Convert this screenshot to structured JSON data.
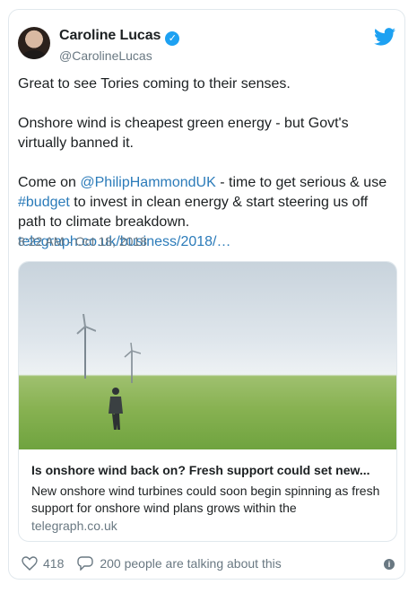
{
  "user": {
    "name": "Caroline Lucas",
    "handle": "@CarolineLucas"
  },
  "tweet": {
    "line1": "Great to see Tories coming to their senses.",
    "line2": "Onshore wind is cheapest green energy - but Govt's virtually banned it.",
    "line3_pre": "Come on ",
    "mention": "@PhilipHammondUK",
    "line3_mid": " - time to get serious & use ",
    "hashtag": "#budget",
    "line3_post": " to invest in clean energy & start steering us off path to climate breakdown. ",
    "url": "telegraph.co.uk/business/2018/…",
    "timestamp": "8:22 AM - Oct 18, 2018"
  },
  "card": {
    "title": "Is onshore wind back on? Fresh support could set new...",
    "description": "New onshore wind turbines could soon begin spinning as fresh support for onshore wind plans grows within the",
    "domain": "telegraph.co.uk"
  },
  "actions": {
    "likes": "418",
    "talking": "200 people are talking about this"
  },
  "colors": {
    "link": "#2b7bb9",
    "verified": "#1da1f2",
    "muted": "#697882"
  },
  "icons": [
    "twitter-bird-icon",
    "verified-icon",
    "heart-icon",
    "reply-icon",
    "info-icon"
  ]
}
